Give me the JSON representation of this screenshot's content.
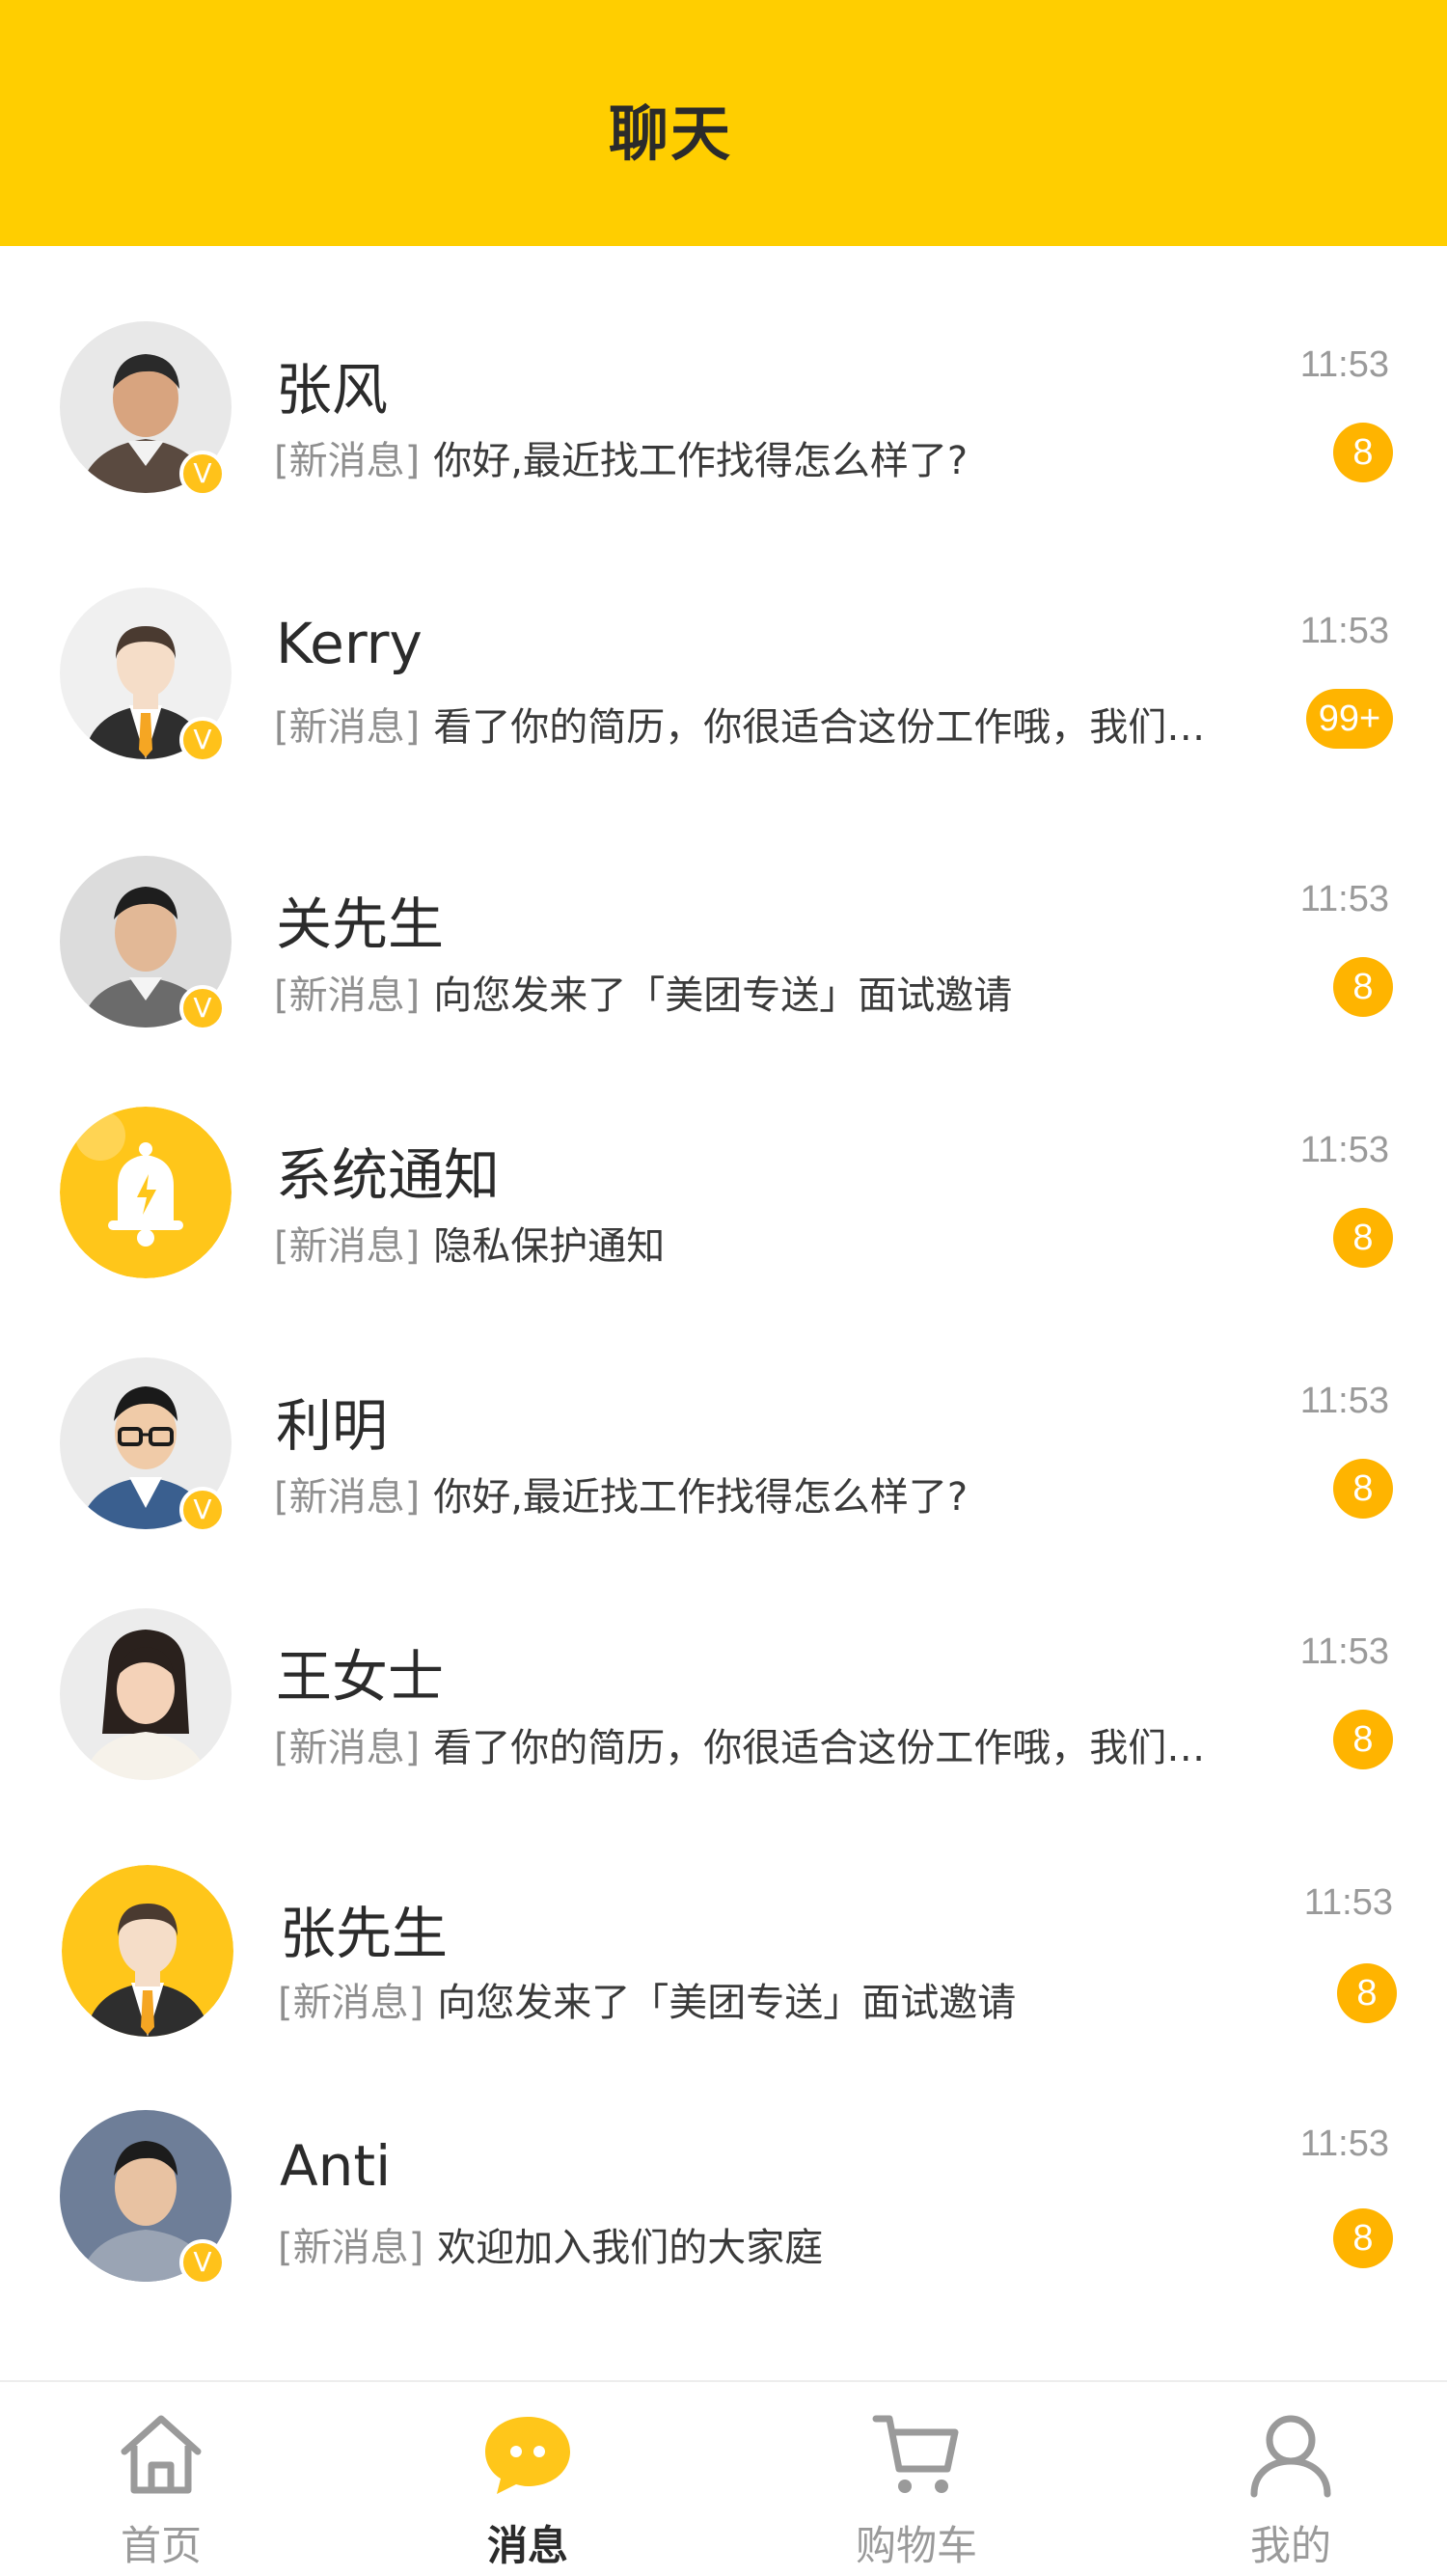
{
  "header": {
    "title": "聊天"
  },
  "accent_color": "#FFCE00",
  "badge_color": "#FFB400",
  "chats": [
    {
      "name": "张风",
      "time": "11:53",
      "tag": "[新消息]",
      "message": "你好,最近找工作找得怎么样了?",
      "unread": "8",
      "verified": true,
      "avatar": "man-photo-avatar"
    },
    {
      "name": "Kerry",
      "time": "11:53",
      "tag": "[新消息]",
      "message": "看了你的简历，你很适合这份工作哦，我们…",
      "unread": "99+",
      "verified": true,
      "avatar": "businessman-avatar"
    },
    {
      "name": "关先生",
      "time": "11:53",
      "tag": "[新消息]",
      "message": "向您发来了「美团专送」面试邀请",
      "unread": "8",
      "verified": true,
      "avatar": "man-photo-avatar"
    },
    {
      "name": "系统通知",
      "time": "11:53",
      "tag": "[新消息]",
      "message": "隐私保护通知",
      "unread": "8",
      "verified": false,
      "avatar": "bell-icon"
    },
    {
      "name": "利明",
      "time": "11:53",
      "tag": "[新消息]",
      "message": "你好,最近找工作找得怎么样了?",
      "unread": "8",
      "verified": true,
      "avatar": "man-glasses-avatar"
    },
    {
      "name": "王女士",
      "time": "11:53",
      "tag": "[新消息]",
      "message": "看了你的简历，你很适合这份工作哦，我们…",
      "unread": "8",
      "verified": false,
      "avatar": "woman-photo-avatar"
    },
    {
      "name": "张先生",
      "time": "11:53",
      "tag": "[新消息]",
      "message": "向您发来了「美团专送」面试邀请",
      "unread": "8",
      "verified": false,
      "avatar": "businessman-yellow-avatar"
    },
    {
      "name": "Anti",
      "time": "11:53",
      "tag": "[新消息]",
      "message": "欢迎加入我们的大家庭",
      "unread": "8",
      "verified": true,
      "avatar": "man-photo-avatar"
    }
  ],
  "tabbar": {
    "items": [
      {
        "label": "首页",
        "icon": "home-icon",
        "active": false
      },
      {
        "label": "消息",
        "icon": "chat-bubble-icon",
        "active": true
      },
      {
        "label": "购物车",
        "icon": "cart-icon",
        "active": false
      },
      {
        "label": "我的",
        "icon": "user-icon",
        "active": false
      }
    ]
  }
}
